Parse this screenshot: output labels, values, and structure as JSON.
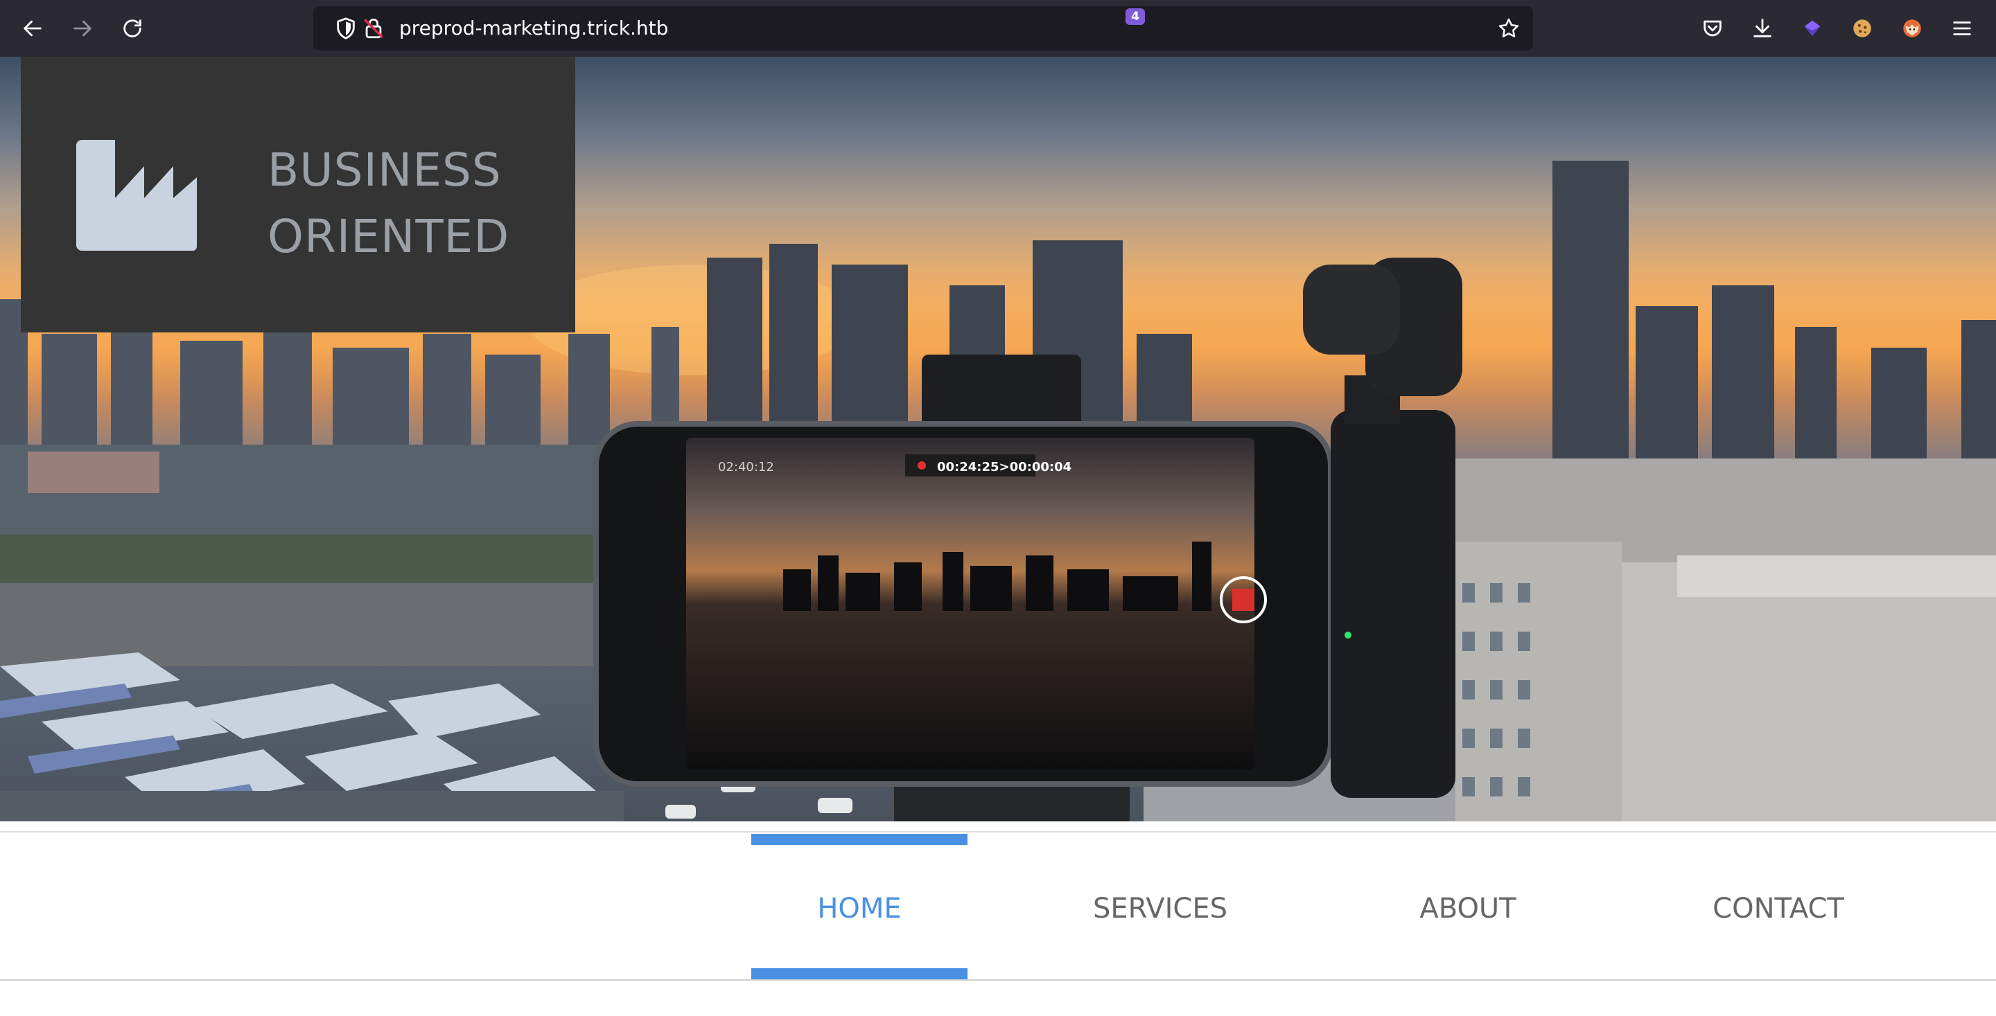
{
  "browser": {
    "url": "preprod-marketing.trick.htb",
    "icons": {
      "back": "arrow-left-icon",
      "forward": "arrow-right-icon",
      "reload": "reload-icon",
      "shield": "tracking-shield-icon",
      "lock": "insecure-lock-icon",
      "bookmark": "star-icon",
      "pocket": "pocket-icon",
      "downloads": "download-icon",
      "extension": "extension-icon",
      "cookie": "cookie-icon",
      "fox": "fox-extension-icon",
      "menu": "hamburger-menu-icon"
    },
    "extension_badge": "4"
  },
  "logo": {
    "line1": "BUSINESS",
    "line2": "ORIENTED",
    "icon": "factory-icon"
  },
  "hero": {
    "overlay_time": "02:40:12",
    "overlay_record": "00:24:25>00:00:04"
  },
  "nav": {
    "items": [
      {
        "label": "HOME",
        "active": true
      },
      {
        "label": "SERVICES",
        "active": false
      },
      {
        "label": "ABOUT",
        "active": false
      },
      {
        "label": "CONTACT",
        "active": false
      }
    ]
  },
  "colors": {
    "accent": "#4a90e2",
    "logo_bg": "#343434",
    "toolbar_bg": "#2b2a33",
    "nav_text": "#666666"
  }
}
